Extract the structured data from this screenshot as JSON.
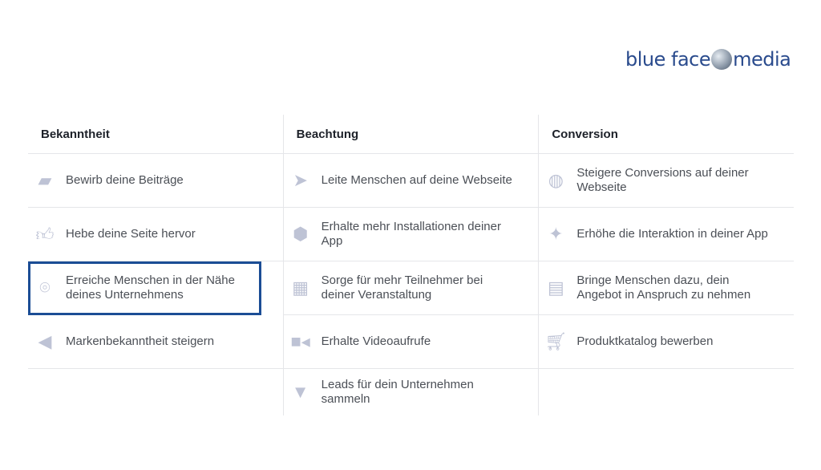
{
  "logo": {
    "left": "blue face",
    "right": "media"
  },
  "columns": [
    {
      "title": "Bekanntheit",
      "items": [
        {
          "label": "Bewirb deine Beiträge",
          "icon": "speech-bubbles-icon"
        },
        {
          "label": "Hebe deine Seite hervor",
          "icon": "thumbs-up-icon"
        },
        {
          "label": "Erreiche Menschen in der Nähe deines Unternehmens",
          "icon": "map-pin-icon",
          "selected": true
        },
        {
          "label": "Markenbekanntheit steigern",
          "icon": "megaphone-icon"
        }
      ]
    },
    {
      "title": "Beachtung",
      "items": [
        {
          "label": "Leite Menschen auf deine Webseite",
          "icon": "cursor-icon"
        },
        {
          "label": "Erhalte mehr Installationen deiner App",
          "icon": "box-icon"
        },
        {
          "label": "Sorge für mehr Teilnehmer bei deiner Veranstaltung",
          "icon": "calendar-icon"
        },
        {
          "label": "Erhalte Videoaufrufe",
          "icon": "video-camera-icon"
        },
        {
          "label": "Leads für dein Unternehmen sammeln",
          "icon": "funnel-icon"
        }
      ]
    },
    {
      "title": "Conversion",
      "items": [
        {
          "label": "Steigere Conversions auf deiner Webseite",
          "icon": "globe-icon"
        },
        {
          "label": "Erhöhe die Interaktion in deiner App",
          "icon": "gamepad-icon"
        },
        {
          "label": "Bringe Menschen dazu, dein Angebot in Anspruch zu nehmen",
          "icon": "storefront-icon"
        },
        {
          "label": "Produktkatalog bewerben",
          "icon": "shopping-cart-icon"
        }
      ]
    }
  ],
  "colors": {
    "selected_border": "#1b4d95",
    "icon": "#bec3d5"
  }
}
